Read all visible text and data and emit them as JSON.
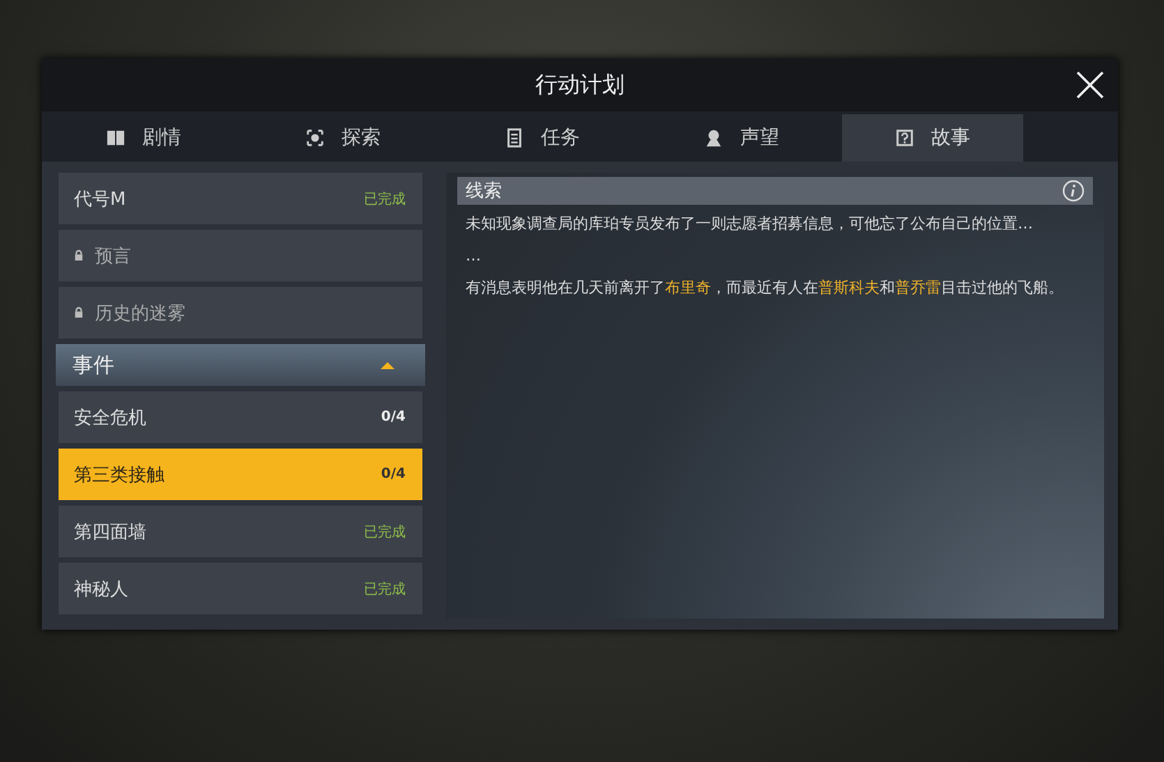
{
  "window": {
    "title": "行动计划"
  },
  "tabs": [
    {
      "label": "剧情",
      "selected": false
    },
    {
      "label": "探索",
      "selected": false
    },
    {
      "label": "任务",
      "selected": false
    },
    {
      "label": "声望",
      "selected": false
    },
    {
      "label": "故事",
      "selected": true
    }
  ],
  "sidebar": {
    "items": [
      {
        "kind": "entry",
        "label": "代号M",
        "locked": false,
        "selected": false,
        "status": "已完成",
        "done": true
      },
      {
        "kind": "entry",
        "label": "预言",
        "locked": true,
        "selected": false
      },
      {
        "kind": "entry",
        "label": "历史的迷雾",
        "locked": true,
        "selected": false
      },
      {
        "kind": "group",
        "label": "事件",
        "expanded": true,
        "children": [
          {
            "kind": "entry",
            "label": "安全危机",
            "locked": false,
            "selected": false,
            "status": "0/4",
            "done": false
          },
          {
            "kind": "entry",
            "label": "第三类接触",
            "locked": false,
            "selected": true,
            "status": "0/4",
            "done": false
          },
          {
            "kind": "entry",
            "label": "第四面墙",
            "locked": false,
            "selected": false,
            "status": "已完成",
            "done": true
          },
          {
            "kind": "entry",
            "label": "神秘人",
            "locked": false,
            "selected": false,
            "status": "已完成",
            "done": true
          }
        ]
      }
    ]
  },
  "detail": {
    "header": "线索",
    "paragraphs": [
      "未知现象调查局的库珀专员发布了一则志愿者招募信息，可他忘了公布自己的位置…",
      "…",
      "有消息表明他在几天前离开了**布里奇**，而最近有人在**普斯科夫**和**普乔雷**目击过他的飞船。"
    ]
  }
}
